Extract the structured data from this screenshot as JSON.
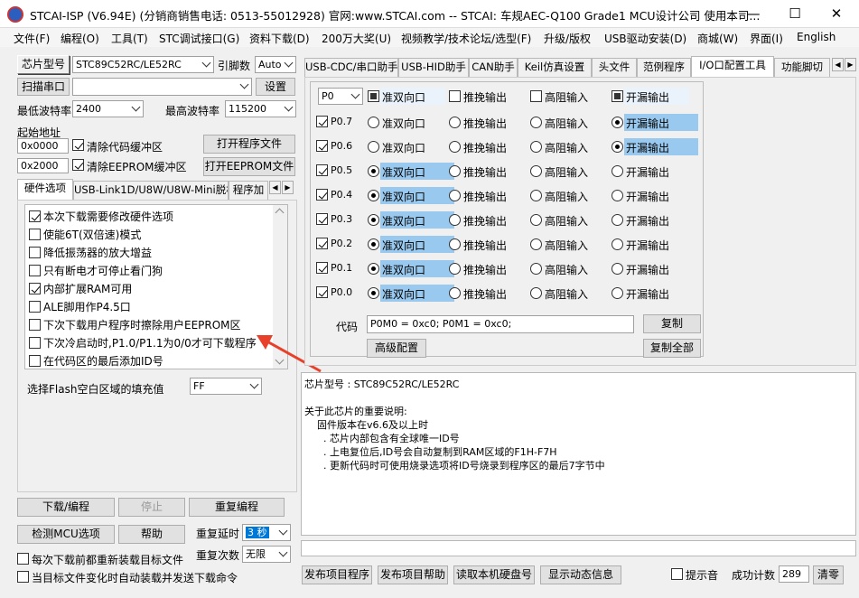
{
  "window": {
    "title": "STCAI-ISP (V6.94E) (分销商销售电话: 0513-55012928) 官网:www.STCAI.com  -- STCAI: 车规AEC-Q100 Grade1 MCU设计公司 使用本司...",
    "minimize": "—",
    "maximize": "☐",
    "close": "✕"
  },
  "menu": [
    "文件(F)",
    "编程(O)",
    "工具(T)",
    "STC调试接口(G)",
    "资料下载(D)",
    "200万大奖(U)",
    "视频教学/技术论坛/选型(F)",
    "升级/版权",
    "USB驱动安装(D)",
    "商城(W)",
    "界面(I)",
    "English"
  ],
  "left": {
    "chip_btn": "芯片型号",
    "chip_value": "STC89C52RC/LE52RC",
    "pins_label": "引脚数",
    "pins_value": "Auto",
    "scan_btn": "扫描串口",
    "port_value": "",
    "settings_btn": "设置",
    "min_baud_label": "最低波特率",
    "min_baud_value": "2400",
    "max_baud_label": "最高波特率",
    "max_baud_value": "115200",
    "start_addr_label": "起始地址",
    "addr1": "0x0000",
    "clear_code": "清除代码缓冲区",
    "open_prog_btn": "打开程序文件",
    "addr2": "0x2000",
    "clear_eeprom": "清除EEPROM缓冲区",
    "open_eeprom_btn": "打开EEPROM文件",
    "tabs": [
      "硬件选项",
      "USB-Link1D/U8W/U8W-Mini脱机",
      "程序加"
    ],
    "hw_options": [
      {
        "label": "本次下载需要修改硬件选项",
        "checked": true
      },
      {
        "label": "使能6T(双倍速)模式",
        "checked": false
      },
      {
        "label": "降低振荡器的放大增益",
        "checked": false
      },
      {
        "label": "只有断电才可停止看门狗",
        "checked": false
      },
      {
        "label": "内部扩展RAM可用",
        "checked": true
      },
      {
        "label": "ALE脚用作P4.5口",
        "checked": false
      },
      {
        "label": "下次下载用户程序时擦除用户EEPROM区",
        "checked": false
      },
      {
        "label": "下次冷启动时,P1.0/P1.1为0/0才可下载程序",
        "checked": false
      },
      {
        "label": "在代码区的最后添加ID号",
        "checked": false
      }
    ],
    "fill_label": "选择Flash空白区域的填充值",
    "fill_value": "FF",
    "download_btn": "下载/编程",
    "stop_btn": "停止",
    "reprogram_btn": "重复编程",
    "detect_btn": "检测MCU选项",
    "help_btn": "帮助",
    "repeat_delay_label": "重复延时",
    "repeat_delay_value": "3 秒",
    "repeat_count_label": "重复次数",
    "repeat_count_value": "无限",
    "reload_label": "每次下载前都重新装载目标文件",
    "auto_send_label": "当目标文件变化时自动装载并发送下载命令"
  },
  "right": {
    "tabs": [
      "USB-CDC/串口助手",
      "USB-HID助手",
      "CAN助手",
      "Keil仿真设置",
      "头文件",
      "范例程序",
      "I/O口配置工具",
      "功能脚切"
    ],
    "io": {
      "port_value": "P0",
      "modes": [
        "准双向口",
        "推挽输出",
        "高阻输入",
        "开漏输出"
      ],
      "header_checks": [
        true,
        false,
        false,
        true
      ],
      "rows": [
        {
          "pin": "P0.7",
          "mode": 3
        },
        {
          "pin": "P0.6",
          "mode": 3
        },
        {
          "pin": "P0.5",
          "mode": 0
        },
        {
          "pin": "P0.4",
          "mode": 0
        },
        {
          "pin": "P0.3",
          "mode": 0
        },
        {
          "pin": "P0.2",
          "mode": 0
        },
        {
          "pin": "P0.1",
          "mode": 0
        },
        {
          "pin": "P0.0",
          "mode": 0
        }
      ],
      "code_label": "代码",
      "code_value": "P0M0 = 0xc0; P0M1 = 0xc0;",
      "copy_btn": "复制",
      "advanced_btn": "高级配置",
      "copy_all_btn": "复制全部"
    },
    "log": [
      "芯片型号 : STC89C52RC/LE52RC",
      "",
      "关于此芯片的重要说明:",
      "    固件版本在v6.6及以上时",
      "      . 芯片内部包含有全球唯一ID号",
      "      . 上电复位后,ID号会自动复制到RAM区域的F1H-F7H",
      "      . 更新代码时可使用烧录选项将ID号烧录到程序区的最后7字节中"
    ],
    "publish_prog_btn": "发布项目程序",
    "publish_help_btn": "发布项目帮助",
    "read_disk_btn": "读取本机硬盘号",
    "show_info_btn": "显示动态信息",
    "beep_label": "提示音",
    "success_label": "成功计数",
    "success_value": "289",
    "clear_btn": "清零"
  },
  "colors": {
    "highlight": "#99c9ef",
    "arrow": "#e8402a"
  }
}
